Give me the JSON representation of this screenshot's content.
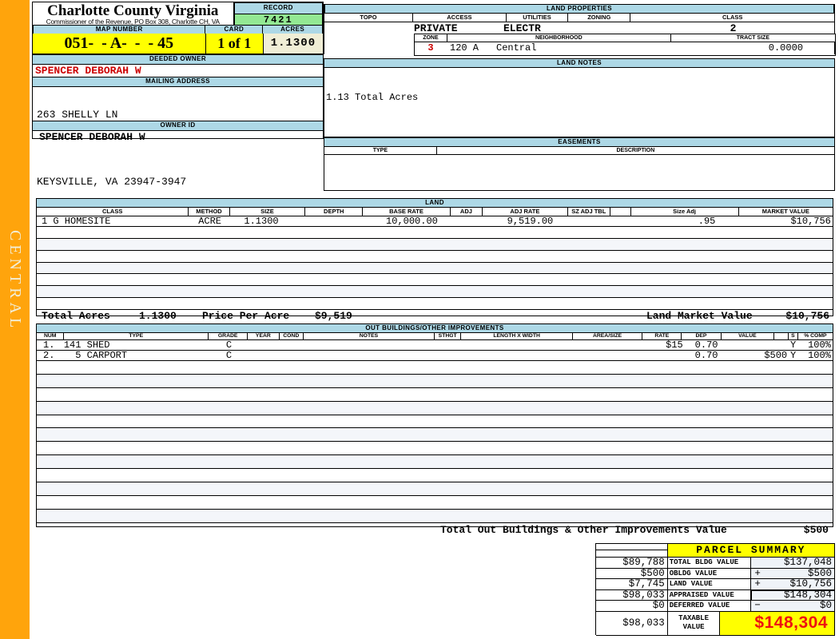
{
  "sidebar": {
    "label": "CENTRAL"
  },
  "header": {
    "county": "Charlotte County Virginia",
    "commissioner": "Commissioner of the Revenue, PO Box 308, Charlotte CH, VA",
    "record_label": "RECORD",
    "record_value": "7421",
    "map_number_label": "MAP NUMBER",
    "map_number": "051-  - A-  -  - 45",
    "card_label": "CARD",
    "card_value": "1 of 1",
    "acres_label": "ACRES",
    "acres_value": "1.1300",
    "deeded_owner_label": "DEEDED OWNER",
    "deeded_owner": "SPENCER DEBORAH W",
    "mailing_address_label": "MAILING ADDRESS",
    "address_line1": "263 SHELLY LN",
    "address_line2": "KEYSVILLE, VA 23947-3947",
    "owner_id_label": "OWNER ID",
    "owner_id": "SPENCER DEBORAH W"
  },
  "land_properties": {
    "title": "LAND PROPERTIES",
    "columns": [
      "TOPO",
      "ACCESS",
      "UTILITIES",
      "ZONING",
      "CLASS"
    ],
    "access": "PRIVATE",
    "utilities": "ELECTR",
    "class": "2",
    "zone_label": "ZONE",
    "zone": "3",
    "neighborhood_label": "NEIGHBORHOOD",
    "neighborhood_code": "120 A",
    "neighborhood_name": "Central",
    "tract_size_label": "TRACT SIZE",
    "tract_size": "0.0000"
  },
  "land_notes": {
    "title": "LAND NOTES",
    "note": "1.13 Total Acres"
  },
  "easements": {
    "title": "EASEMENTS",
    "type_label": "TYPE",
    "description_label": "DESCRIPTION"
  },
  "land": {
    "title": "LAND",
    "columns": [
      "CLASS",
      "METHOD",
      "SIZE",
      "DEPTH",
      "BASE RATE",
      "ADJ",
      "ADJ RATE",
      "SZ ADJ TBL",
      "",
      "Size Adj",
      "MARKET VALUE"
    ],
    "rows": [
      {
        "class": "1 G HOMESITE",
        "method": "ACRE",
        "size": "1.1300",
        "depth": "",
        "base_rate": "10,000.00",
        "adj": "",
        "adj_rate": "9,519.00",
        "sz_adj_tbl": "",
        "size_adj": ".95",
        "market_value": "$10,756"
      }
    ],
    "totals": {
      "total_acres_label": "Total Acres",
      "total_acres": "1.1300",
      "price_per_acre_label": "Price Per Acre",
      "price_per_acre": "$9,519",
      "land_market_value_label": "Land Market Value",
      "land_market_value": "$10,756"
    }
  },
  "out_buildings": {
    "title": "OUT BUILDINGS/OTHER IMPROVEMENTS",
    "columns": [
      "NUM",
      "TYPE",
      "GRADE",
      "YEAR",
      "COND",
      "NOTES",
      "STHGT",
      "LENGTH X WIDTH",
      "AREA/SIZE",
      "RATE",
      "DEP",
      "VALUE",
      "",
      "S",
      "% COMP"
    ],
    "rows": [
      {
        "num": "1.",
        "type": "141 SHED",
        "grade": "C",
        "rate": "$15",
        "dep": "0.70",
        "value": "",
        "s": "Y",
        "comp": "100%"
      },
      {
        "num": "2.",
        "type": "  5 CARPORT",
        "grade": "C",
        "rate": "",
        "dep": "0.70",
        "value": "$500",
        "s": "Y",
        "comp": "100%"
      }
    ],
    "total_label": "Total Out Buildings & Other Improvements Value",
    "total_value": "$500"
  },
  "parcel_summary": {
    "title": "PARCEL SUMMARY",
    "rows": [
      {
        "prior": "$89,788",
        "label": "TOTAL BLDG VALUE",
        "op": "",
        "value": "$137,048"
      },
      {
        "prior": "$500",
        "label": "OBLDG VALUE",
        "op": "+",
        "value": "$500"
      },
      {
        "prior": "$7,745",
        "label": "LAND VALUE",
        "op": "+",
        "value": "$10,756"
      },
      {
        "prior": "$98,033",
        "label": "APPRAISED VALUE",
        "op": "",
        "value": "$148,304"
      },
      {
        "prior": "$0",
        "label": "DEFERRED VALUE",
        "op": "−",
        "value": "$0"
      }
    ],
    "taxable": {
      "prior": "$98,033",
      "label_line1": "TAXABLE",
      "label_line2": "VALUE",
      "value": "$148,304"
    }
  },
  "colors": {
    "section_bar": "#ADD8E6",
    "highlight_yellow": "#FFFF00",
    "record_green": "#93E893",
    "acres_cream": "#F0EED6",
    "sidebar_orange": "#FFA40C",
    "owner_red": "#CC0000",
    "taxable_red": "#EE1111"
  }
}
